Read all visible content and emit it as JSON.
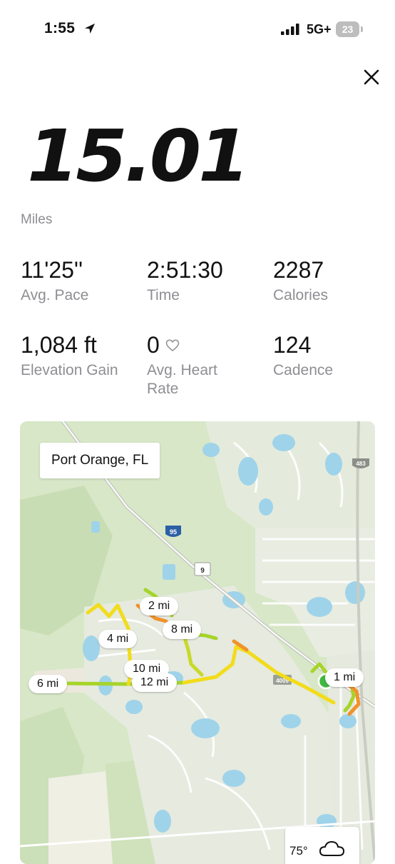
{
  "status_bar": {
    "time": "1:55",
    "network": "5G+",
    "battery": "23"
  },
  "workout": {
    "distance": "15.01",
    "distance_unit": "Miles",
    "stats": [
      {
        "value": "11'25''",
        "label": "Avg. Pace"
      },
      {
        "value": "2:51:30",
        "label": "Time"
      },
      {
        "value": "2287",
        "label": "Calories"
      },
      {
        "value": "1,084 ft",
        "label": "Elevation Gain"
      },
      {
        "value": "0",
        "label": "Avg. Heart Rate"
      },
      {
        "value": "124",
        "label": "Cadence"
      }
    ]
  },
  "map": {
    "location": "Port Orange, FL",
    "highway_shields": [
      "95",
      "9",
      "483",
      "4009"
    ],
    "mile_markers": [
      "1 mi",
      "2 mi",
      "4 mi",
      "6 mi",
      "8 mi",
      "10 mi",
      "12 mi"
    ],
    "weather_temp": "75°"
  },
  "colors": {
    "route_green": "#a6d42a",
    "route_yellow": "#f2dc1b",
    "route_orange": "#f0922b",
    "start_marker": "#3fb83f"
  }
}
